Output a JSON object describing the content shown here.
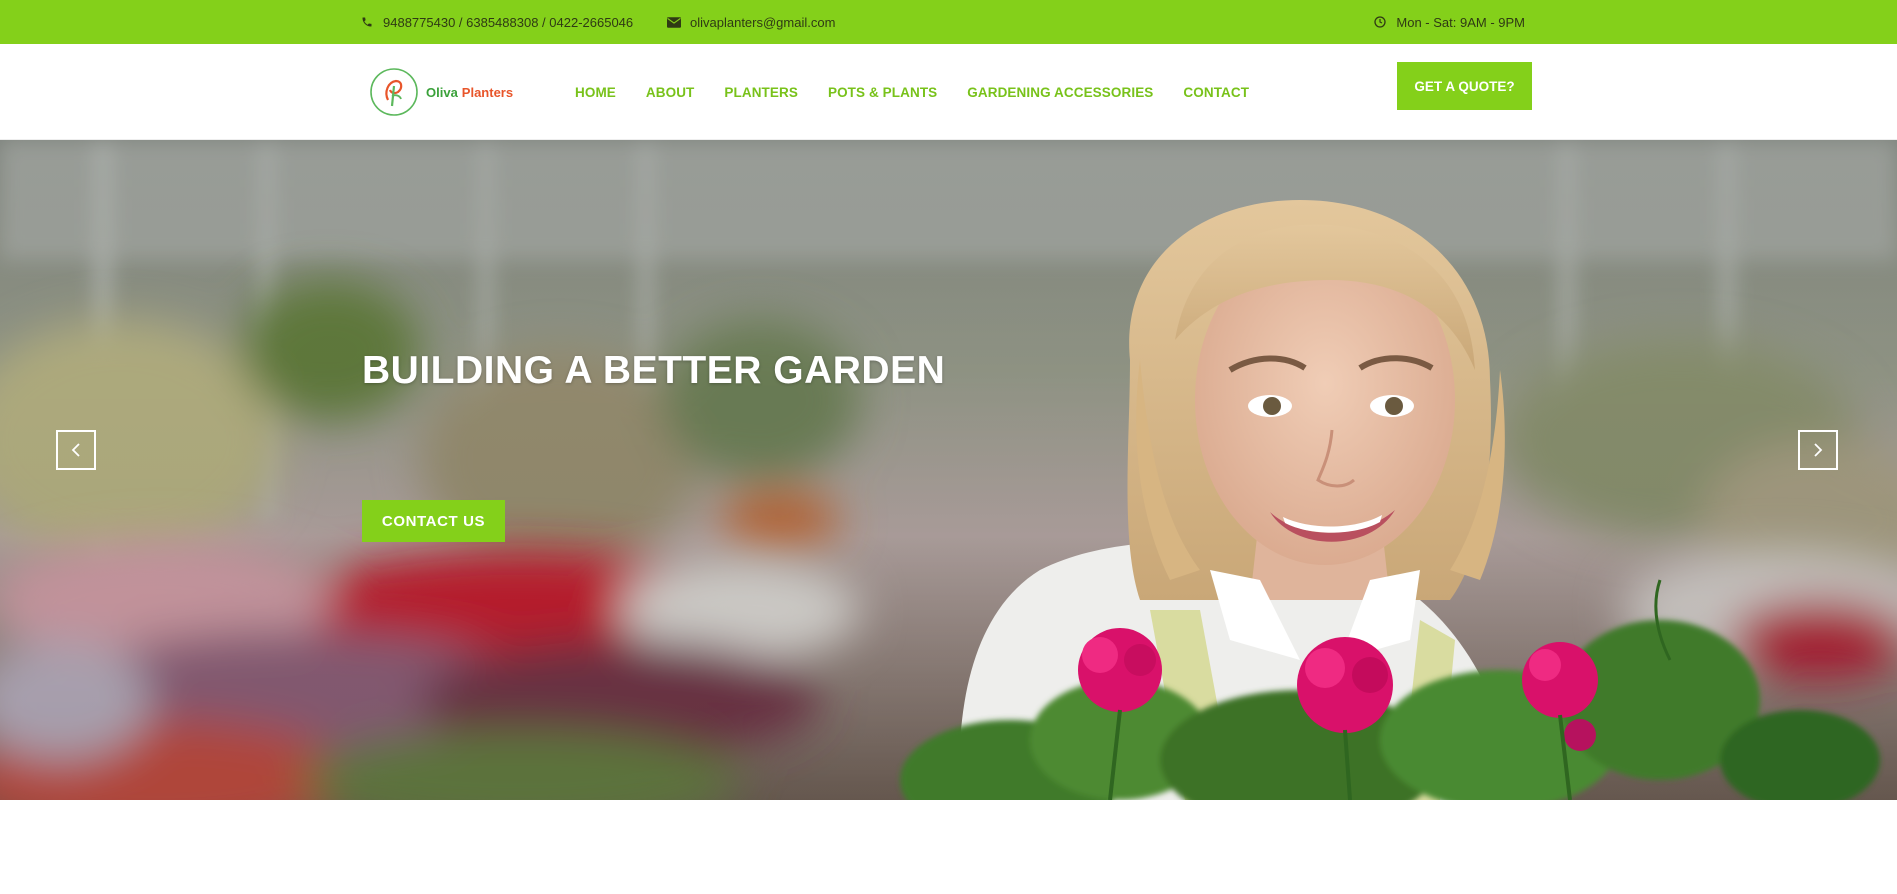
{
  "topbar": {
    "phones": "9488775430 / 6385488308 / 0422-2665046",
    "email": "olivaplanters@gmail.com",
    "hours": "Mon - Sat: 9AM - 9PM"
  },
  "header": {
    "logo": {
      "word1": "Oliva",
      "word2": "Planters"
    },
    "nav": [
      {
        "label": "HOME"
      },
      {
        "label": "ABOUT"
      },
      {
        "label": "PLANTERS"
      },
      {
        "label": "POTS & PLANTS"
      },
      {
        "label": "GARDENING ACCESSORIES"
      },
      {
        "label": "CONTACT"
      }
    ],
    "quote_button": "GET A QUOTE?"
  },
  "hero": {
    "title": "BUILDING A BETTER GARDEN",
    "cta": "CONTACT US"
  },
  "colors": {
    "brand_green": "#84d01a",
    "nav_green": "#78c21a",
    "logo_orange": "#e8552a"
  },
  "icons": [
    "phone-icon",
    "envelope-icon",
    "clock-icon",
    "chevron-left-icon",
    "chevron-right-icon"
  ]
}
